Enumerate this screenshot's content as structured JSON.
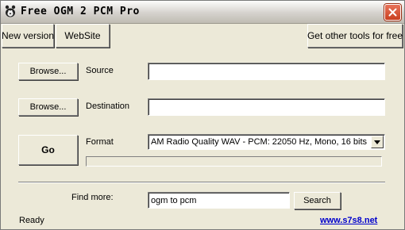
{
  "window": {
    "title": "Free OGM 2 PCM Pro",
    "close_label": "✕"
  },
  "toolbar": {
    "new_version": "New version",
    "website": "WebSite",
    "other_tools": "Get other tools for free"
  },
  "source": {
    "browse_label": "Browse...",
    "label": "Source",
    "value": ""
  },
  "destination": {
    "browse_label": "Browse...",
    "label": "Destination",
    "value": ""
  },
  "convert": {
    "go_label": "Go",
    "format_label": "Format",
    "format_value": "AM Radio Quality WAV - PCM: 22050 Hz, Mono, 16 bits",
    "progress": 0
  },
  "find_more": {
    "label": "Find more:",
    "query": "ogm to pcm",
    "search_label": "Search"
  },
  "status": {
    "text": "Ready",
    "link": "www.s7s8.net"
  },
  "colors": {
    "window_bg": "#ECE9D8",
    "link": "#0000CC",
    "close_button": "#D2522F"
  }
}
